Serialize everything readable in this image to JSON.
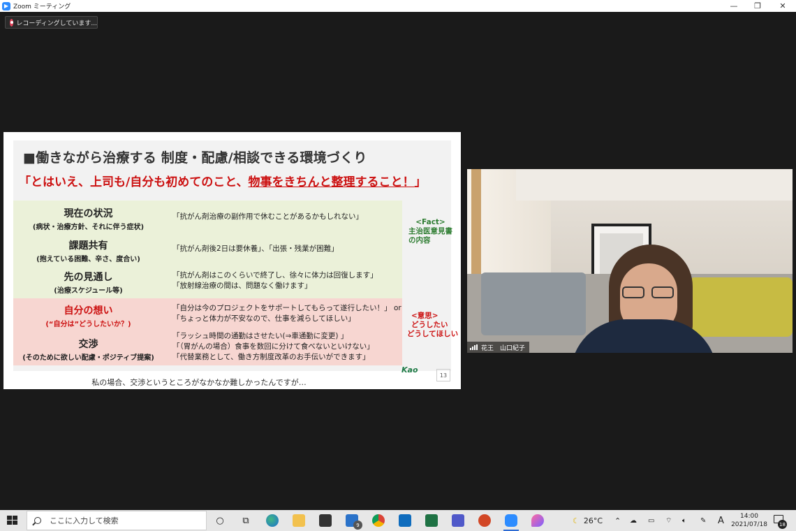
{
  "window": {
    "title": "Zoom ミーティング",
    "minimize": "—",
    "restore": "❐",
    "close": "✕"
  },
  "recording": {
    "label": "レコーディングしています..."
  },
  "slide": {
    "heading": "■働きながら治療する 制度・配慮/相談できる環境づくり",
    "subheading_pre": "「とはいえ、上司も/自分も初めてのこと、",
    "subheading_underlined": "物事をきちんと整理すること！",
    "subheading_post": "」",
    "rows": [
      {
        "title": "現在の状況",
        "subtitle": "(病状・治療方針、それに伴う症状)",
        "lines": [
          "「抗がん剤治療の副作用で休むことがあるかもしれない」"
        ]
      },
      {
        "title": "課題共有",
        "subtitle": "(抱えている困難、辛さ、度合い)",
        "lines": [
          "「抗がん剤後2日は要休養」、「出張・残業が困難」"
        ]
      },
      {
        "title": "先の見通し",
        "subtitle": "(治療スケジュール等)",
        "lines": [
          "「抗がん剤はこのくらいで終了し、徐々に体力は回復します」",
          "「放射線治療の間は、問題なく働けます」"
        ]
      },
      {
        "title": "自分の想い",
        "subtitle": "(“自分は”どうしたいか？)",
        "lines": [
          "「自分は今のプロジェクトをサポートしてもらって遂行したい！」 or",
          "「ちょっと体力が不安なので、仕事を減らしてほしい」"
        ]
      },
      {
        "title": "交渉",
        "subtitle": "(そのために欲しい配慮・ポジティブ提案)",
        "lines": [
          "「ラッシュ時間の通勤はさせたい(⇒車通勤に変更) 」",
          "「（胃がんの場合）食事を数回に分けて食べないといけない」",
          "「代替業務として、働き方制度改革のお手伝いができます」"
        ]
      }
    ],
    "fact_note": [
      "<Fact>",
      "主治医意見書",
      "の内容"
    ],
    "ishi_note": [
      "<意思>",
      "どうしたい",
      "どうしてほしい"
    ],
    "caption": "私の場合、交渉というところがなかなか難しかったんですが…",
    "logo": "Kao",
    "page_number": "13"
  },
  "video": {
    "name": "花王　山口紀子"
  },
  "taskbar": {
    "search_placeholder": "ここに入力して検索",
    "mail_badge": "9",
    "weather": "26°C",
    "ime": "A",
    "time": "14:00",
    "date": "2021/07/18",
    "notification_count": "18"
  },
  "colors": {
    "fact_bg": "#ebf1d9",
    "ishi_bg": "#f7d6d1",
    "accent_red": "#cc1111",
    "accent_green": "#2e7d32",
    "zoom_blue": "#2d8cff"
  }
}
